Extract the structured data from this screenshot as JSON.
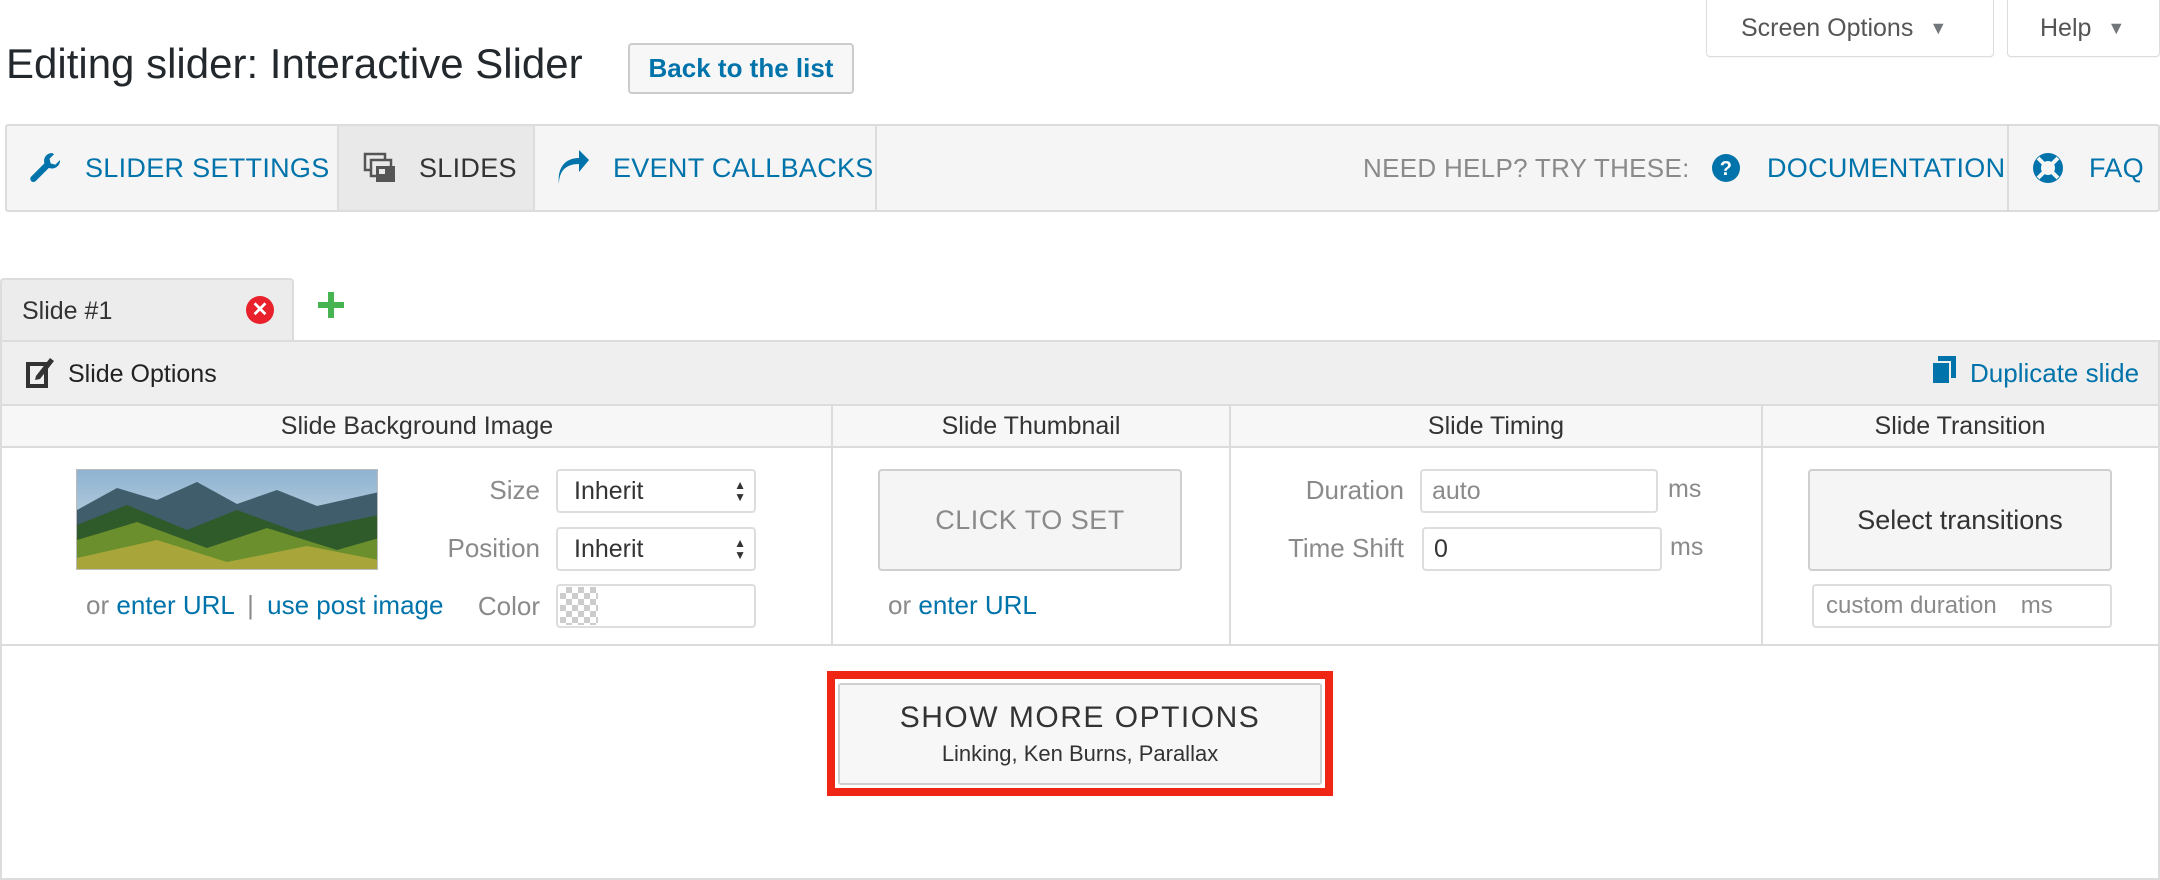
{
  "screen_meta": {
    "screen_options_label": "Screen Options",
    "help_label": "Help"
  },
  "header": {
    "title": "Editing slider: Interactive Slider",
    "back_button": "Back to the list"
  },
  "nav": {
    "slider_settings": "SLIDER SETTINGS",
    "slides": "SLIDES",
    "event_callbacks": "EVENT CALLBACKS",
    "need_help": "NEED HELP? TRY THESE:",
    "documentation": "DOCUMENTATION",
    "faq": "FAQ"
  },
  "slide_tabs": {
    "active_tab": "Slide #1"
  },
  "panel": {
    "options_title": "Slide Options",
    "duplicate": "Duplicate slide",
    "columns": {
      "background": "Slide Background Image",
      "thumbnail": "Slide Thumbnail",
      "timing": "Slide Timing",
      "transition": "Slide Transition"
    },
    "background": {
      "size_label": "Size",
      "size_value": "Inherit",
      "position_label": "Position",
      "position_value": "Inherit",
      "color_label": "Color",
      "or": "or",
      "enter_url": "enter URL",
      "separator": "|",
      "use_post_image": "use post image"
    },
    "thumbnail": {
      "click_to_set": "CLICK TO SET",
      "or": "or",
      "enter_url": "enter URL"
    },
    "timing": {
      "duration_label": "Duration",
      "duration_placeholder": "auto",
      "time_shift_label": "Time Shift",
      "time_shift_value": "0",
      "unit": "ms"
    },
    "transition": {
      "select_button": "Select transitions",
      "custom_duration_placeholder": "custom duration",
      "unit": "ms"
    },
    "more_options": {
      "title": "SHOW MORE OPTIONS",
      "subtitle": "Linking, Ken Burns, Parallax"
    }
  },
  "colors": {
    "link": "#0073aa",
    "highlight": "#ee2613",
    "close": "#e8212b",
    "add": "#46b450"
  }
}
